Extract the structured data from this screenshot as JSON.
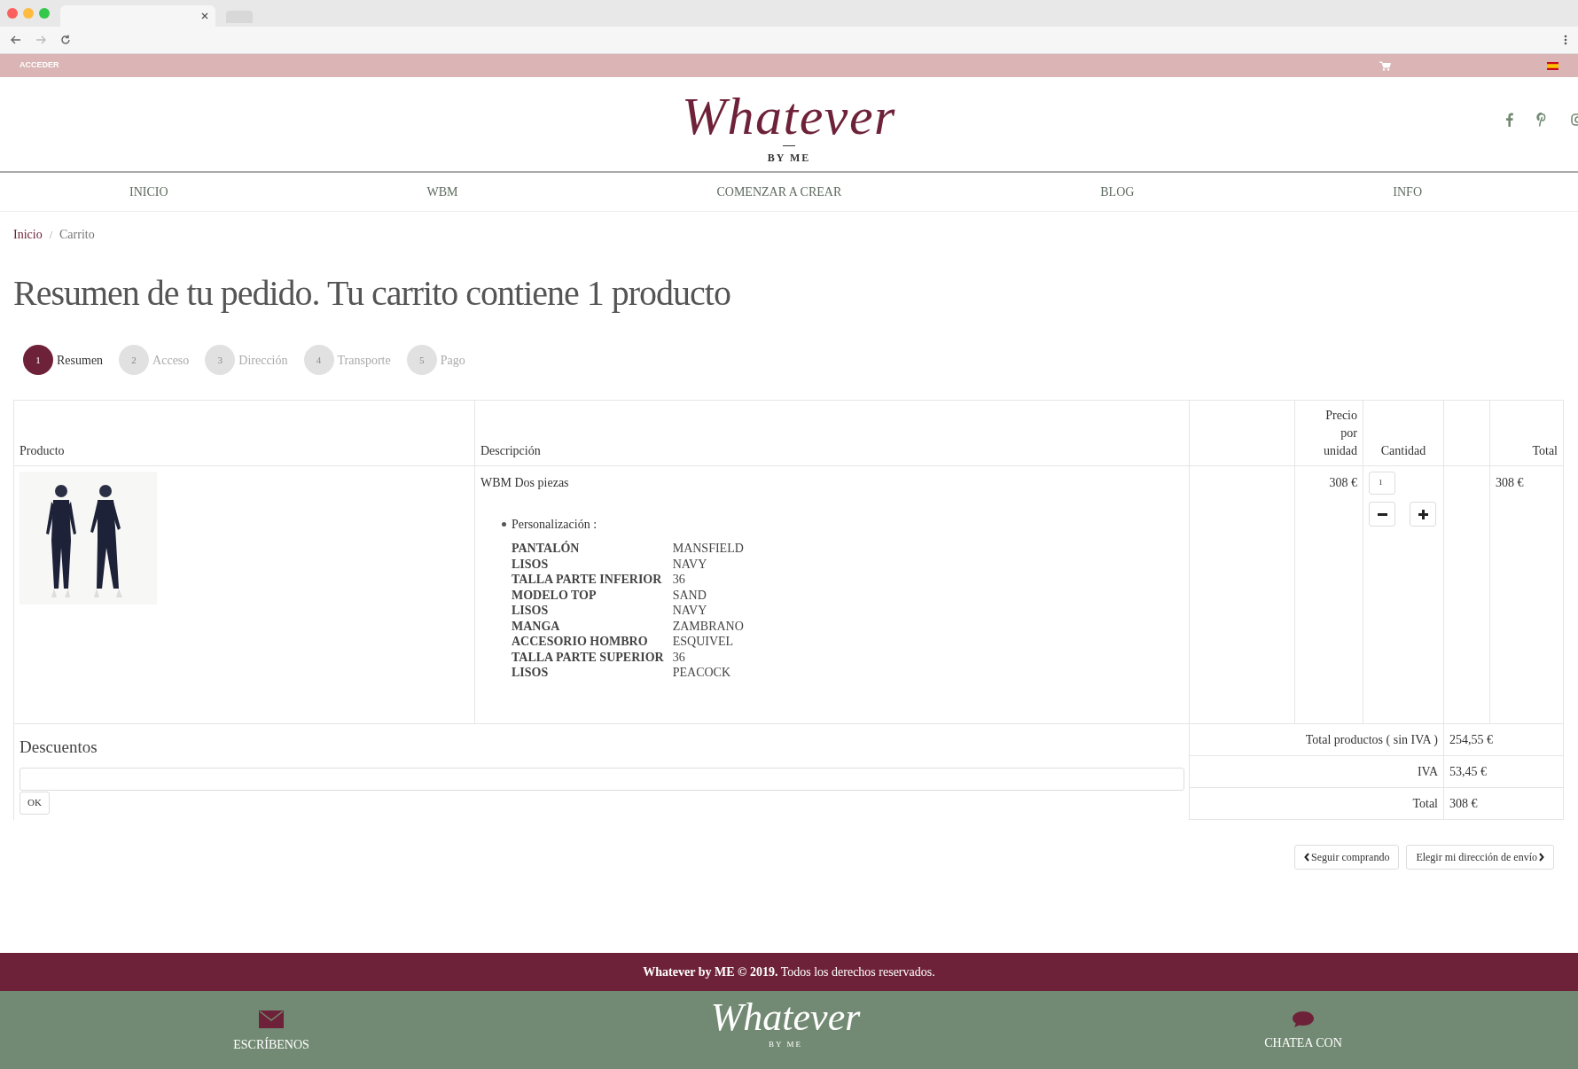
{
  "top_bar": {
    "login": "ACCEDER"
  },
  "logo": {
    "script": "Whatever",
    "tagline": "BY ME"
  },
  "nav": [
    "INICIO",
    "WBM",
    "COMENZAR A CREAR",
    "BLOG",
    "INFO"
  ],
  "breadcrumb": [
    {
      "label": "Inicio",
      "kind": "link"
    },
    {
      "label": "Carrito",
      "kind": "current"
    }
  ],
  "breadcrumb_separator": "/",
  "title": "Resumen de tu pedido. Tu carrito contiene 1 producto",
  "steps": [
    {
      "number": "1",
      "label": "Resumen",
      "selected": true
    },
    {
      "number": "2",
      "label": "Acceso",
      "selected": false
    },
    {
      "number": "3",
      "label": "Dirección",
      "selected": false
    },
    {
      "number": "4",
      "label": "Transporte",
      "selected": false
    },
    {
      "number": "5",
      "label": "Pago",
      "selected": false
    }
  ],
  "table": {
    "columns": {
      "product": "Producto",
      "description": "Descripción",
      "unit_price": "Precio por unidad",
      "quantity": "Cantidad",
      "total": "Total"
    },
    "rows": [
      {
        "name": "WBM Dos piezas",
        "customization_label": "Personalización :",
        "attributes": [
          {
            "name": "PANTALÓN",
            "value": "MANSFIELD"
          },
          {
            "name": "LISOS",
            "value": "NAVY"
          },
          {
            "name": "TALLA PARTE INFERIOR",
            "value": "36"
          },
          {
            "name": "MODELO TOP",
            "value": "SAND"
          },
          {
            "name": "LISOS",
            "value": "NAVY"
          },
          {
            "name": "MANGA",
            "value": "ZAMBRANO"
          },
          {
            "name": "ACCESORIO HOMBRO",
            "value": "ESQUIVEL"
          },
          {
            "name": "TALLA PARTE SUPERIOR",
            "value": "36"
          },
          {
            "name": "LISOS",
            "value": "PEACOCK"
          }
        ],
        "unit_price": "308 €",
        "quantity": "1",
        "total": "308 €"
      }
    ]
  },
  "discounts": {
    "title": "Descuentos",
    "button": "OK"
  },
  "summary": [
    {
      "label": "Total productos ( sin IVA )",
      "value": "254,55 €"
    },
    {
      "label": "IVA",
      "value": "53,45 €"
    },
    {
      "label": "Total",
      "value": "308 €"
    }
  ],
  "actions": [
    {
      "label": "Seguir comprando",
      "kind": "back"
    },
    {
      "label": "Elegir mi dirección de envío",
      "kind": "next"
    }
  ],
  "footer": {
    "copyright": "**Whatever by ME © 2019.** Todos los derechos reservados.",
    "contact": "ESCRÍBENOS",
    "logo_script": "Whatever",
    "logo_tagline": "BY ME",
    "chat": "CHATEA CON"
  }
}
